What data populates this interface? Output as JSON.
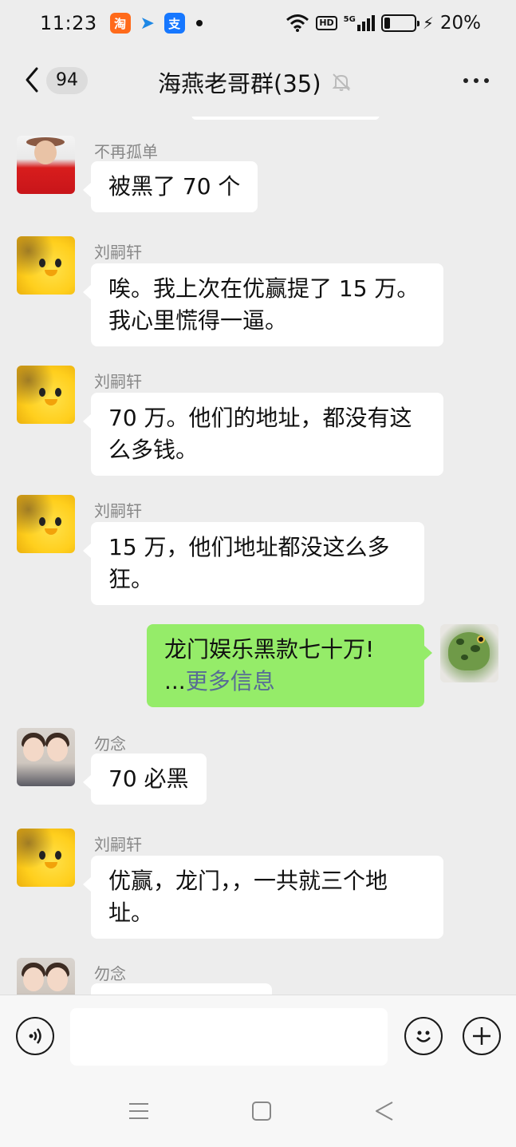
{
  "status_bar": {
    "time": "11:23",
    "apps": [
      "taobao-icon",
      "feishu-icon",
      "alipay-icon"
    ],
    "hd_label": "HD",
    "network": "5G",
    "battery_percent": 20,
    "battery_label": "20%"
  },
  "header": {
    "unread_count": "94",
    "title": "海燕老哥群(35)",
    "muted": true
  },
  "messages": [
    {
      "direction": "in",
      "sender": "不再孤单",
      "text_lines": [
        "被黑了 70 个"
      ],
      "avatar": "red-suit-avatar"
    },
    {
      "direction": "in",
      "sender": "刘嗣轩",
      "text_lines": [
        "唉。我上次在优赢提了 15 万。",
        "我心里慌得一逼。"
      ],
      "avatar": "yellow-chick-avatar"
    },
    {
      "direction": "in",
      "sender": "刘嗣轩",
      "text_lines": [
        "70 万。他们的地址，都没有这",
        "么多钱。"
      ],
      "avatar": "yellow-chick-avatar"
    },
    {
      "direction": "in",
      "sender": "刘嗣轩",
      "text_lines": [
        "15 万，他们地址都没这么多",
        "狂。"
      ],
      "avatar": "yellow-chick-avatar"
    },
    {
      "direction": "out",
      "text_lines": [
        "龙门娱乐黑款七十万!"
      ],
      "more_prefix": "...",
      "more_link": "更多信息",
      "avatar": "frog-avatar"
    },
    {
      "direction": "in",
      "sender": "勿念",
      "text_lines": [
        "70 必黑"
      ],
      "avatar": "twin-girls-avatar"
    },
    {
      "direction": "in",
      "sender": "刘嗣轩",
      "text_lines": [
        "优赢，龙门，，一共就三个地",
        "址。"
      ],
      "avatar": "yellow-chick-avatar"
    },
    {
      "direction": "in",
      "sender": "勿念",
      "text_lines": [
        ""
      ],
      "avatar": "twin-girls-avatar"
    }
  ],
  "input_bar": {
    "placeholder": ""
  },
  "colors": {
    "background": "#ededed",
    "bubble_in": "#ffffff",
    "bubble_out": "#95ec69",
    "link": "#576b95",
    "sender_name": "#888888"
  }
}
